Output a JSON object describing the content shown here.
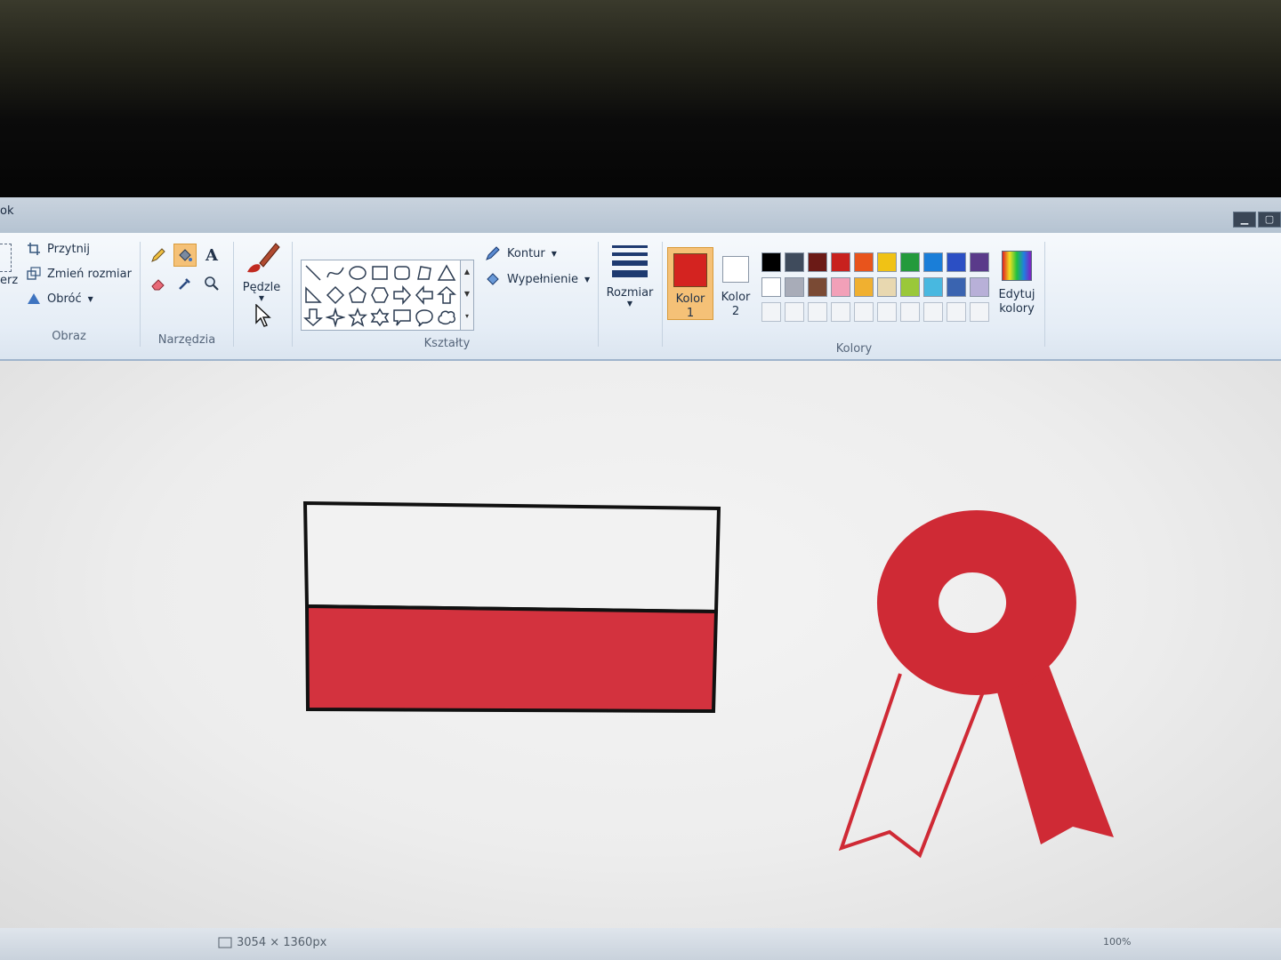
{
  "menu": {
    "partial_label": "ok"
  },
  "ribbon": {
    "image_group": {
      "label": "Obraz",
      "select_partial": "erz",
      "crop": "Przytnij",
      "resize": "Zmień rozmiar",
      "rotate": "Obróć"
    },
    "tools_group": {
      "label": "Narzędzia"
    },
    "brushes": {
      "label": "Pędzle"
    },
    "shapes_group": {
      "label": "Kształty",
      "outline": "Kontur",
      "fill": "Wypełnienie"
    },
    "size": {
      "label": "Rozmiar"
    },
    "colors_group": {
      "label": "Kolory",
      "color1_line1": "Kolor",
      "color1_line2": "1",
      "color2_line1": "Kolor",
      "color2_line2": "2",
      "edit_line1": "Edytuj",
      "edit_line2": "kolory",
      "color1_value": "#d42320",
      "color2_value": "#ffffff",
      "palette_row1": [
        "#000000",
        "#3f4b5c",
        "#6b1a16",
        "#c8211e",
        "#e8541c",
        "#f0c215",
        "#249a3c",
        "#1a7ed8",
        "#2b4fc4",
        "#5a3a8a"
      ],
      "palette_row2": [
        "#ffffff",
        "#a8acb8",
        "#7a4a34",
        "#f2a0b8",
        "#f0b030",
        "#e8d8b0",
        "#9ac83a",
        "#48b8e0",
        "#3a64b0",
        "#b8b0d8"
      ]
    }
  },
  "canvas": {
    "flag_top_color": "#f2f2f2",
    "flag_bottom_color": "#d3323e",
    "ribbon_color": "#cf2a35"
  },
  "status": {
    "dimensions": "3054 × 1360px",
    "zoom": "100%"
  }
}
